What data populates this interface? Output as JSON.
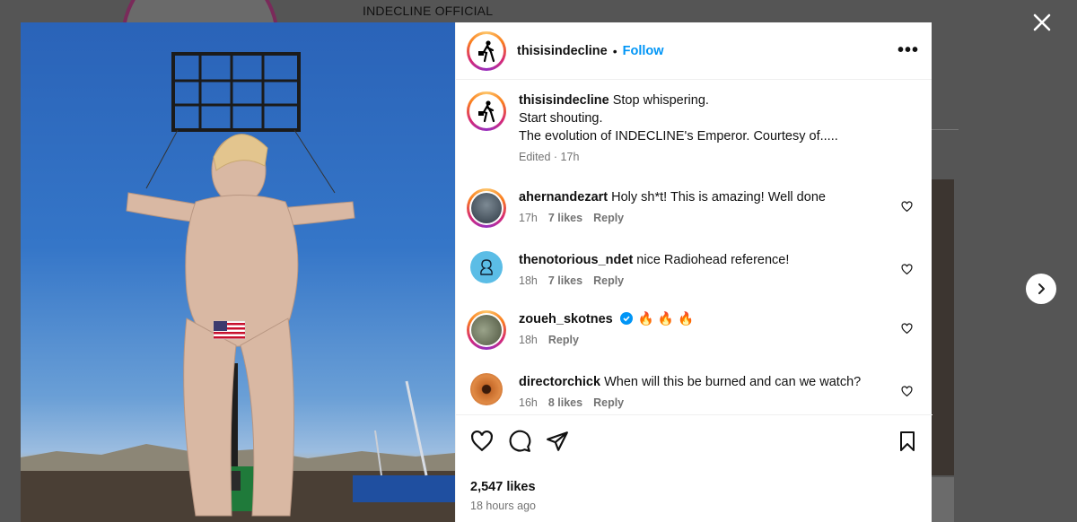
{
  "background": {
    "profile_name": "INDECLINE OFFICIAL"
  },
  "post": {
    "author": "thisisindecline",
    "separator": "•",
    "follow_label": "Follow",
    "more_icon": "more-horizontal-icon",
    "caption": {
      "username": "thisisindecline",
      "lines": [
        "Stop whispering.",
        "Start shouting.",
        "The evolution of INDECLINE's Emperor. Courtesy of....."
      ],
      "meta": "Edited · 17h"
    },
    "comments": [
      {
        "username": "ahernandezart",
        "text": "Holy sh*t! This is amazing! Well done",
        "time": "17h",
        "likes": "7 likes",
        "reply": "Reply",
        "has_ring": true
      },
      {
        "username": "thenotorious_ndet",
        "text": "nice Radiohead reference!",
        "time": "18h",
        "likes": "7 likes",
        "reply": "Reply",
        "has_ring": false
      },
      {
        "username": "zoueh_skotnes",
        "text": "🔥 🔥 🔥",
        "time": "18h",
        "reply": "Reply",
        "verified": true,
        "has_ring": true
      },
      {
        "username": "directorchick",
        "text": "When will this be burned and can we watch?",
        "time": "16h",
        "likes": "8 likes",
        "reply": "Reply",
        "has_ring": false
      }
    ],
    "likes_count": "2,547 likes",
    "posted": "18 hours ago"
  },
  "colors": {
    "follow": "#0095f6",
    "muted": "#737373",
    "verified": "#0095f6"
  }
}
